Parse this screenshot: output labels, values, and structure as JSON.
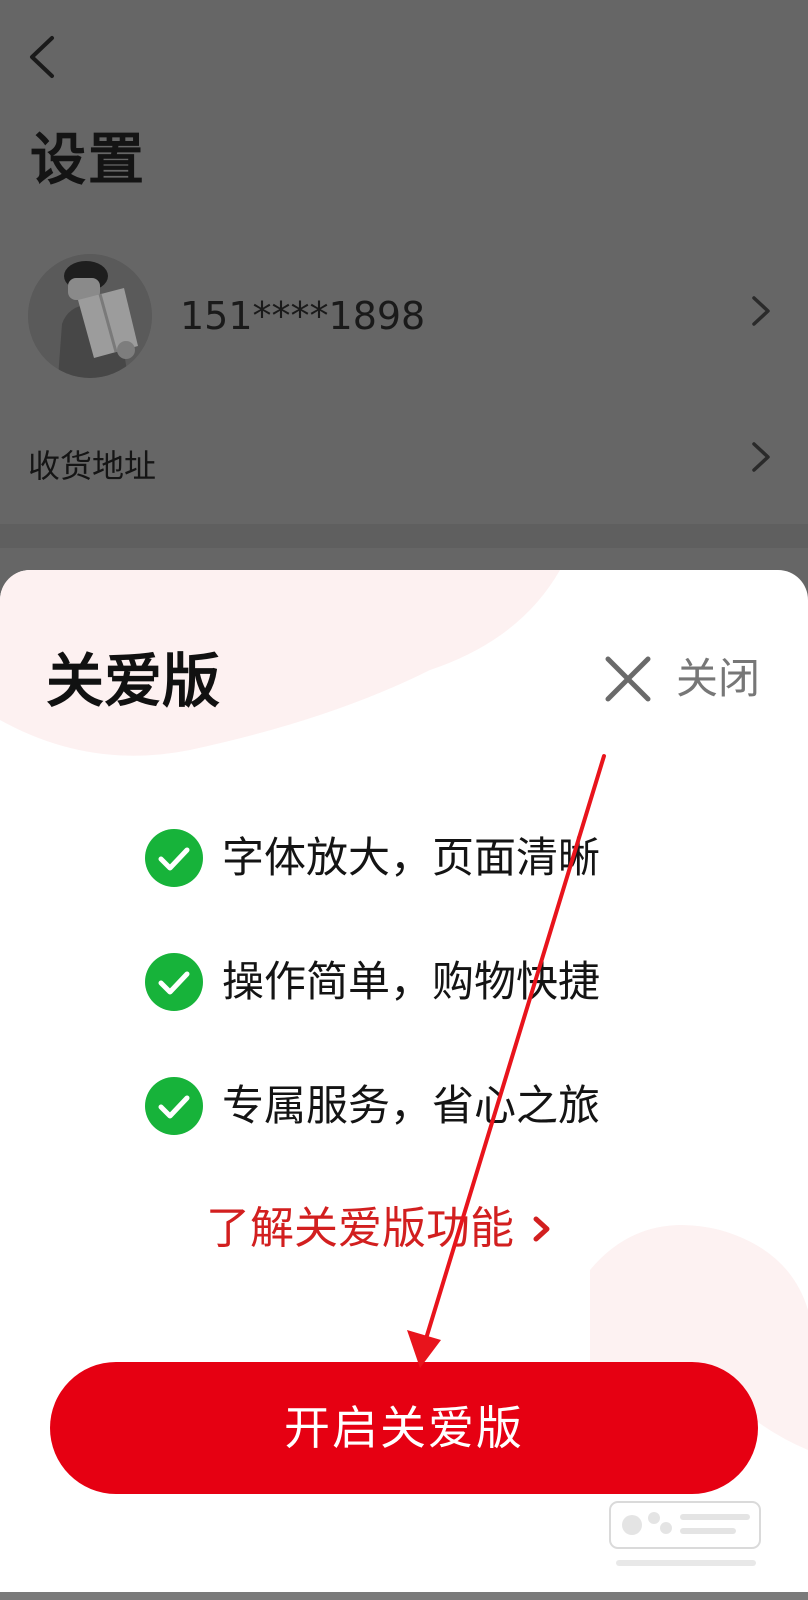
{
  "settings_page": {
    "title": "设置",
    "account": {
      "phone": "151****1898"
    },
    "address_row": {
      "label": "收货地址"
    }
  },
  "care_sheet": {
    "title": "关爱版",
    "close_label": "关闭",
    "features": [
      {
        "text": "字体放大，页面清晰"
      },
      {
        "text": "操作简单，购物快捷"
      },
      {
        "text": "专属服务，省心之旅"
      }
    ],
    "learn_more": "了解关爱版功能",
    "primary_button": "开启关爱版"
  },
  "icons": {
    "back": "chevron-left-icon",
    "row_arrow": "chevron-right-icon",
    "close": "close-icon",
    "feature_check": "check-circle-icon"
  },
  "colors": {
    "accent": "#e60012",
    "check": "#17b33a",
    "link": "#d21f1f",
    "overlay": "#666666"
  }
}
